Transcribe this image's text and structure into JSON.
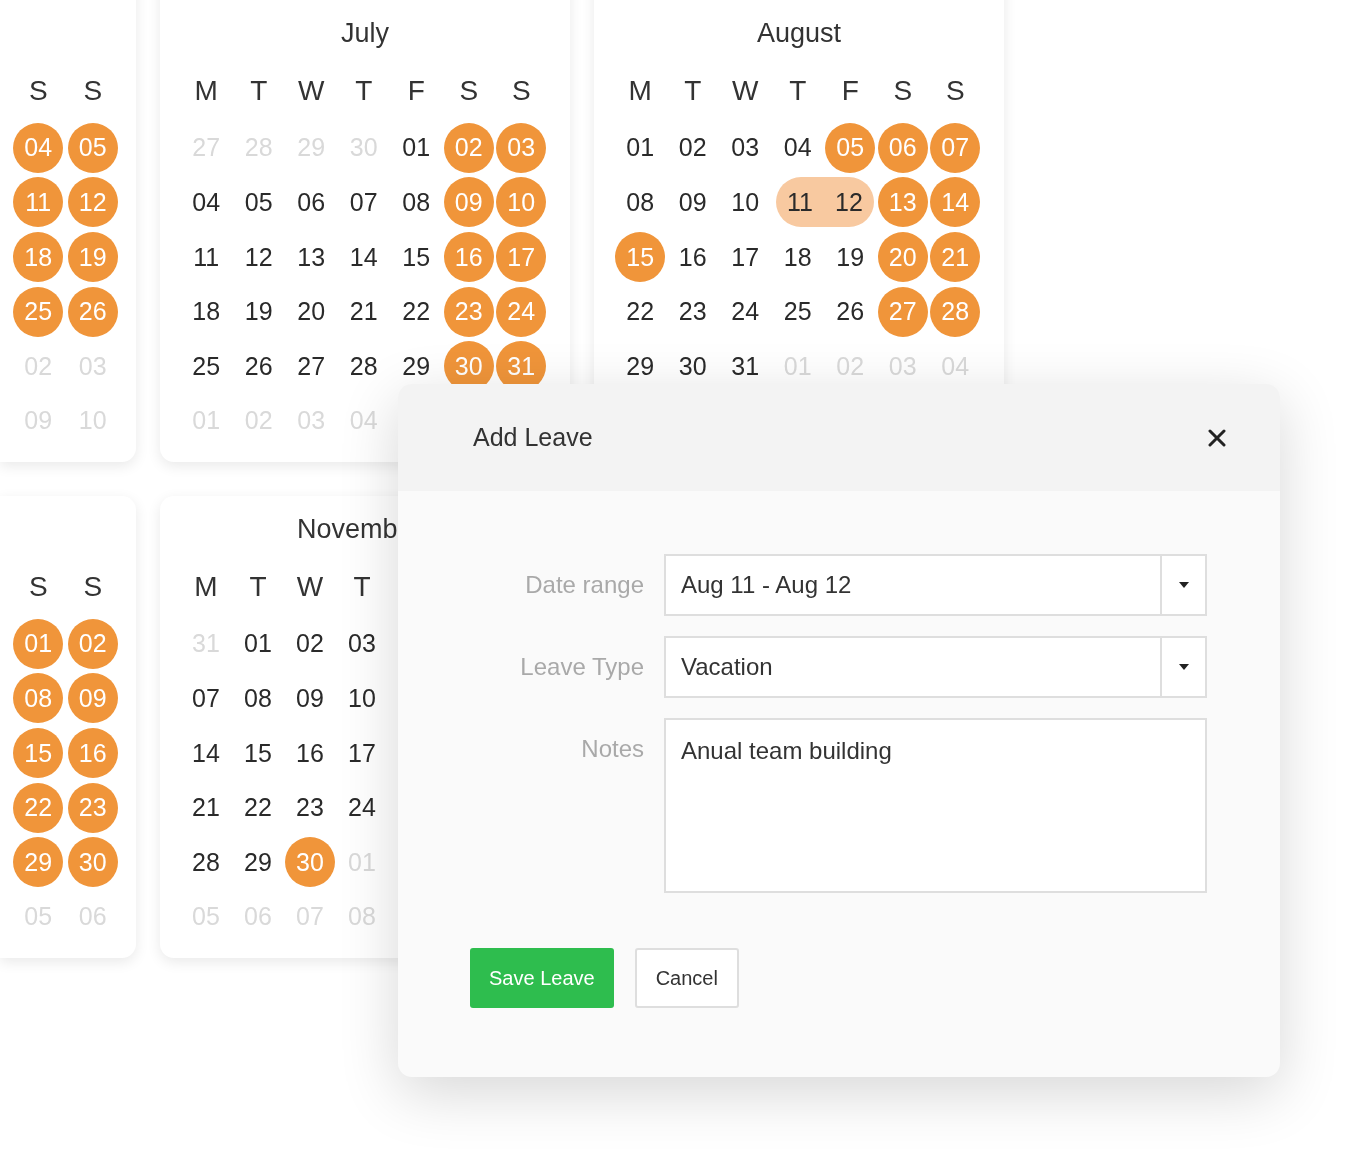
{
  "calendars_top": [
    {
      "kind": "cut_left",
      "weekdays": [
        "S",
        "S"
      ],
      "weeks": [
        [
          {
            "text": "04",
            "kind": "marked"
          },
          {
            "text": "05",
            "kind": "marked"
          }
        ],
        [
          {
            "text": "11",
            "kind": "marked"
          },
          {
            "text": "12",
            "kind": "marked"
          }
        ],
        [
          {
            "text": "18",
            "kind": "marked"
          },
          {
            "text": "19",
            "kind": "marked"
          }
        ],
        [
          {
            "text": "25",
            "kind": "marked"
          },
          {
            "text": "26",
            "kind": "marked"
          }
        ],
        [
          {
            "text": "02",
            "kind": "outside"
          },
          {
            "text": "03",
            "kind": "outside"
          }
        ],
        [
          {
            "text": "09",
            "kind": "outside"
          },
          {
            "text": "10",
            "kind": "outside"
          }
        ]
      ]
    },
    {
      "kind": "full",
      "title": "July",
      "weekdays": [
        "M",
        "T",
        "W",
        "T",
        "F",
        "S",
        "S"
      ],
      "weeks": [
        [
          {
            "text": "27",
            "kind": "outside"
          },
          {
            "text": "28",
            "kind": "outside"
          },
          {
            "text": "29",
            "kind": "outside"
          },
          {
            "text": "30",
            "kind": "outside"
          },
          {
            "text": "01",
            "kind": "day"
          },
          {
            "text": "02",
            "kind": "marked"
          },
          {
            "text": "03",
            "kind": "marked"
          }
        ],
        [
          {
            "text": "04",
            "kind": "day"
          },
          {
            "text": "05",
            "kind": "day"
          },
          {
            "text": "06",
            "kind": "day"
          },
          {
            "text": "07",
            "kind": "day"
          },
          {
            "text": "08",
            "kind": "day"
          },
          {
            "text": "09",
            "kind": "marked"
          },
          {
            "text": "10",
            "kind": "marked"
          }
        ],
        [
          {
            "text": "11",
            "kind": "day"
          },
          {
            "text": "12",
            "kind": "day"
          },
          {
            "text": "13",
            "kind": "day"
          },
          {
            "text": "14",
            "kind": "day"
          },
          {
            "text": "15",
            "kind": "day"
          },
          {
            "text": "16",
            "kind": "marked"
          },
          {
            "text": "17",
            "kind": "marked"
          }
        ],
        [
          {
            "text": "18",
            "kind": "day"
          },
          {
            "text": "19",
            "kind": "day"
          },
          {
            "text": "20",
            "kind": "day"
          },
          {
            "text": "21",
            "kind": "day"
          },
          {
            "text": "22",
            "kind": "day"
          },
          {
            "text": "23",
            "kind": "marked"
          },
          {
            "text": "24",
            "kind": "marked"
          }
        ],
        [
          {
            "text": "25",
            "kind": "day"
          },
          {
            "text": "26",
            "kind": "day"
          },
          {
            "text": "27",
            "kind": "day"
          },
          {
            "text": "28",
            "kind": "day"
          },
          {
            "text": "29",
            "kind": "day"
          },
          {
            "text": "30",
            "kind": "marked"
          },
          {
            "text": "31",
            "kind": "marked"
          }
        ],
        [
          {
            "text": "01",
            "kind": "outside"
          },
          {
            "text": "02",
            "kind": "outside"
          },
          {
            "text": "03",
            "kind": "outside"
          },
          {
            "text": "04",
            "kind": "outside"
          }
        ]
      ]
    },
    {
      "kind": "full",
      "title": "August",
      "weekdays": [
        "M",
        "T",
        "W",
        "T",
        "F",
        "S",
        "S"
      ],
      "weeks": [
        [
          {
            "text": "01",
            "kind": "day"
          },
          {
            "text": "02",
            "kind": "day"
          },
          {
            "text": "03",
            "kind": "day"
          },
          {
            "text": "04",
            "kind": "day"
          },
          {
            "text": "05",
            "kind": "marked"
          },
          {
            "text": "06",
            "kind": "marked"
          },
          {
            "text": "07",
            "kind": "marked"
          }
        ],
        [
          {
            "text": "08",
            "kind": "day"
          },
          {
            "text": "09",
            "kind": "day"
          },
          {
            "text": "10",
            "kind": "day"
          },
          {
            "text": "11",
            "kind": "range_start"
          },
          {
            "text": "12",
            "kind": "range_end"
          },
          {
            "text": "13",
            "kind": "marked"
          },
          {
            "text": "14",
            "kind": "marked"
          }
        ],
        [
          {
            "text": "15",
            "kind": "marked"
          },
          {
            "text": "16",
            "kind": "day"
          },
          {
            "text": "17",
            "kind": "day"
          },
          {
            "text": "18",
            "kind": "day"
          },
          {
            "text": "19",
            "kind": "day"
          },
          {
            "text": "20",
            "kind": "marked"
          },
          {
            "text": "21",
            "kind": "marked"
          }
        ],
        [
          {
            "text": "22",
            "kind": "day"
          },
          {
            "text": "23",
            "kind": "day"
          },
          {
            "text": "24",
            "kind": "day"
          },
          {
            "text": "25",
            "kind": "day"
          },
          {
            "text": "26",
            "kind": "day"
          },
          {
            "text": "27",
            "kind": "marked"
          },
          {
            "text": "28",
            "kind": "marked"
          }
        ],
        [
          {
            "text": "29",
            "kind": "day"
          },
          {
            "text": "30",
            "kind": "day"
          },
          {
            "text": "31",
            "kind": "day"
          },
          {
            "text": "01",
            "kind": "outside"
          },
          {
            "text": "02",
            "kind": "outside"
          },
          {
            "text": "03",
            "kind": "outside"
          },
          {
            "text": "04",
            "kind": "outside"
          }
        ]
      ]
    }
  ],
  "calendars_bottom": [
    {
      "kind": "cut_left",
      "weekdays": [
        "S",
        "S"
      ],
      "weeks": [
        [
          {
            "text": "01",
            "kind": "marked"
          },
          {
            "text": "02",
            "kind": "marked"
          }
        ],
        [
          {
            "text": "08",
            "kind": "marked"
          },
          {
            "text": "09",
            "kind": "marked"
          }
        ],
        [
          {
            "text": "15",
            "kind": "marked"
          },
          {
            "text": "16",
            "kind": "marked"
          }
        ],
        [
          {
            "text": "22",
            "kind": "marked"
          },
          {
            "text": "23",
            "kind": "marked"
          }
        ],
        [
          {
            "text": "29",
            "kind": "marked"
          },
          {
            "text": "30",
            "kind": "marked"
          }
        ],
        [
          {
            "text": "05",
            "kind": "outside"
          },
          {
            "text": "06",
            "kind": "outside"
          }
        ]
      ]
    },
    {
      "kind": "cut_right",
      "title": "Novemb",
      "weekdays": [
        "M",
        "T",
        "W",
        "T"
      ],
      "weeks": [
        [
          {
            "text": "31",
            "kind": "outside"
          },
          {
            "text": "01",
            "kind": "day"
          },
          {
            "text": "02",
            "kind": "day"
          },
          {
            "text": "03",
            "kind": "day"
          }
        ],
        [
          {
            "text": "07",
            "kind": "day"
          },
          {
            "text": "08",
            "kind": "day"
          },
          {
            "text": "09",
            "kind": "day"
          },
          {
            "text": "10",
            "kind": "day"
          }
        ],
        [
          {
            "text": "14",
            "kind": "day"
          },
          {
            "text": "15",
            "kind": "day"
          },
          {
            "text": "16",
            "kind": "day"
          },
          {
            "text": "17",
            "kind": "day"
          }
        ],
        [
          {
            "text": "21",
            "kind": "day"
          },
          {
            "text": "22",
            "kind": "day"
          },
          {
            "text": "23",
            "kind": "day"
          },
          {
            "text": "24",
            "kind": "day"
          }
        ],
        [
          {
            "text": "28",
            "kind": "day"
          },
          {
            "text": "29",
            "kind": "day"
          },
          {
            "text": "30",
            "kind": "marked"
          },
          {
            "text": "01",
            "kind": "outside"
          }
        ],
        [
          {
            "text": "05",
            "kind": "outside"
          },
          {
            "text": "06",
            "kind": "outside"
          },
          {
            "text": "07",
            "kind": "outside"
          },
          {
            "text": "08",
            "kind": "outside"
          }
        ]
      ]
    }
  ],
  "dialog": {
    "title": "Add Leave",
    "fields": [
      {
        "kind": "select",
        "label": "Date range",
        "value": "Aug 11 - Aug 12"
      },
      {
        "kind": "select",
        "label": "Leave Type",
        "value": "Vacation"
      },
      {
        "kind": "textarea",
        "label": "Notes",
        "value": "Anual team building"
      }
    ],
    "buttons": [
      {
        "kind": "primary",
        "label": "Save Leave"
      },
      {
        "kind": "secondary",
        "label": "Cancel"
      }
    ]
  }
}
